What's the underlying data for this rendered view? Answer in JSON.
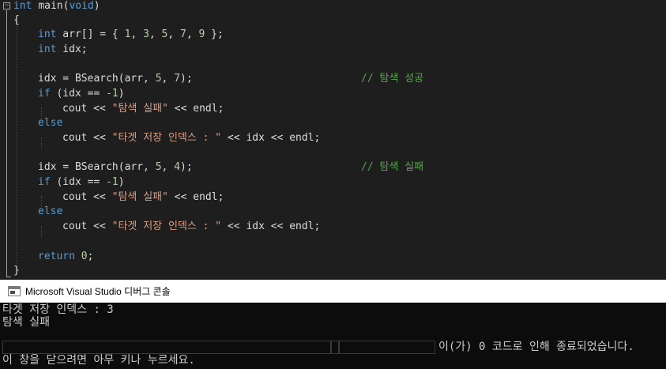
{
  "editor": {
    "line1": {
      "kw": "int",
      "fn": "main",
      "paren_open": "(",
      "param": "void",
      "paren_close": ")"
    },
    "line2": "{",
    "line3": {
      "kw": "int",
      "rest1": " arr[] = { ",
      "n1": "1",
      "c1": ", ",
      "n2": "3",
      "c2": ", ",
      "n3": "5",
      "c3": ", ",
      "n4": "7",
      "c4": ", ",
      "n5": "9",
      "rest2": " };"
    },
    "line4": {
      "kw": "int",
      "rest": " idx;"
    },
    "line6": {
      "var": "idx",
      "rest1": " = BSearch(arr, ",
      "n1": "5",
      "c1": ", ",
      "n2": "7",
      "rest2": ");",
      "comment": "// 탐색 성공"
    },
    "line7": {
      "kw": "if",
      "rest1": " (idx == ",
      "num": "-1",
      "rest2": ")"
    },
    "line8": {
      "pre": "cout << ",
      "str": "\"탐색 실패\"",
      "post": " << endl;"
    },
    "line9": {
      "kw": "else"
    },
    "line10": {
      "pre": "cout << ",
      "str": "\"타겟 저장 인덱스 : \"",
      "post": " << idx << endl;"
    },
    "line12": {
      "var": "idx",
      "rest1": " = BSearch(arr, ",
      "n1": "5",
      "c1": ", ",
      "n2": "4",
      "rest2": ");",
      "comment": "// 탐색 실패"
    },
    "line13": {
      "kw": "if",
      "rest1": " (idx == ",
      "num": "-1",
      "rest2": ")"
    },
    "line14": {
      "pre": "cout << ",
      "str": "\"탐색 실패\"",
      "post": " << endl;"
    },
    "line15": {
      "kw": "else"
    },
    "line16": {
      "pre": "cout << ",
      "str": "\"타겟 저장 인덱스 : \"",
      "post": " << idx << endl;"
    },
    "line18": {
      "kw": "return",
      "num": "0",
      "post": ";"
    },
    "line19": "}",
    "fold_symbol": "−"
  },
  "console": {
    "title": "Microsoft Visual Studio 디버그 콘솔",
    "output": [
      "타겟 저장 인덱스 : 3",
      "탐색 실패"
    ],
    "exit_message": "이(가) 0 코드로 인해 종료되었습니다.",
    "close_hint": "이 창을 닫으려면 아무 키나 누르세요."
  },
  "colors": {
    "editor_bg": "#1e1e1e",
    "keyword": "#569cd6",
    "string": "#d69d85",
    "number": "#b5cea8",
    "comment": "#57a64a",
    "console_bg": "#0c0c0c",
    "console_text": "#cccccc"
  }
}
